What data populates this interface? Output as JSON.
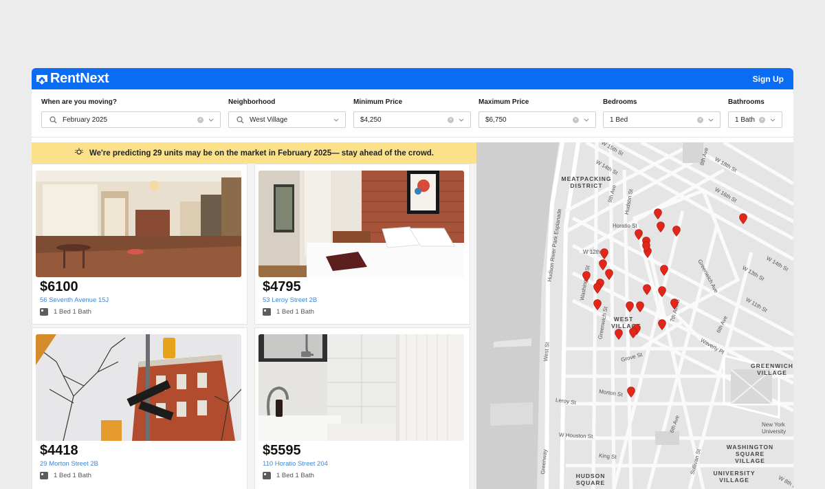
{
  "header": {
    "brand": "RentNext",
    "sign_up": "Sign Up",
    "brand_color": "#0a6cf2"
  },
  "filters": [
    {
      "label": "When are you moving?",
      "value": "February 2025",
      "clearable": true,
      "leading_icon": "search-icon"
    },
    {
      "label": "Neighborhood",
      "value": "West Village",
      "clearable": false,
      "leading_icon": "search-icon"
    },
    {
      "label": "Minimum Price",
      "value": "$4,250",
      "clearable": true
    },
    {
      "label": "Maximum Price",
      "value": "$6,750",
      "clearable": true
    },
    {
      "label": "Bedrooms",
      "value": "1 Bed",
      "clearable": true
    },
    {
      "label": "Bathrooms",
      "value": "1 Bath",
      "clearable": true
    }
  ],
  "banner": {
    "text": "We're predicting 29 units may be on the market in February 2025— stay ahead of the crowd.",
    "icon": "lightbulb-icon",
    "color": "#fbe189"
  },
  "listings": [
    {
      "price": "$6100",
      "address": "56 Seventh Avenue 15J",
      "details": "1 Bed 1 Bath",
      "photo": "lobby"
    },
    {
      "price": "$4795",
      "address": "53 Leroy Street 2B",
      "details": "1 Bed 1 Bath",
      "photo": "bedroom"
    },
    {
      "price": "$4418",
      "address": "29 Morton Street 2B",
      "details": "1 Bed 1 Bath",
      "photo": "street"
    },
    {
      "price": "$5595",
      "address": "110 Horatio Street 204",
      "details": "1 Bed 1 Bath",
      "photo": "bathroom"
    }
  ],
  "map": {
    "labels": [
      "W 15th St",
      "W 14th St",
      "W 18th St",
      "W 16th St",
      "MEATPACKING DISTRICT",
      "9th Ave",
      "Hudson St",
      "Horatio St",
      "W 12th St",
      "Hudson River Park Esplanade",
      "Greenwich Ave",
      "W 14th St",
      "W 13th St",
      "W 11th St",
      "Washington St",
      "Greenwich St",
      "7th Ave S",
      "6th Ave",
      "WEST VILLAGE",
      "Waverly Pl",
      "West St",
      "Grove St",
      "GREENWICH VILLAGE",
      "Leroy St",
      "Morton St",
      "New York University",
      "W Houston St",
      "WASHINGTON SQUARE VILLAGE",
      "King St",
      "Sullivan St",
      "UNIVERSITY VILLAGE",
      "HUDSON SQUARE",
      "Greenway",
      "6th Ave",
      "8th Ave",
      "W 8th St"
    ],
    "pin_color": "#e2261a",
    "pin_count": 26
  }
}
